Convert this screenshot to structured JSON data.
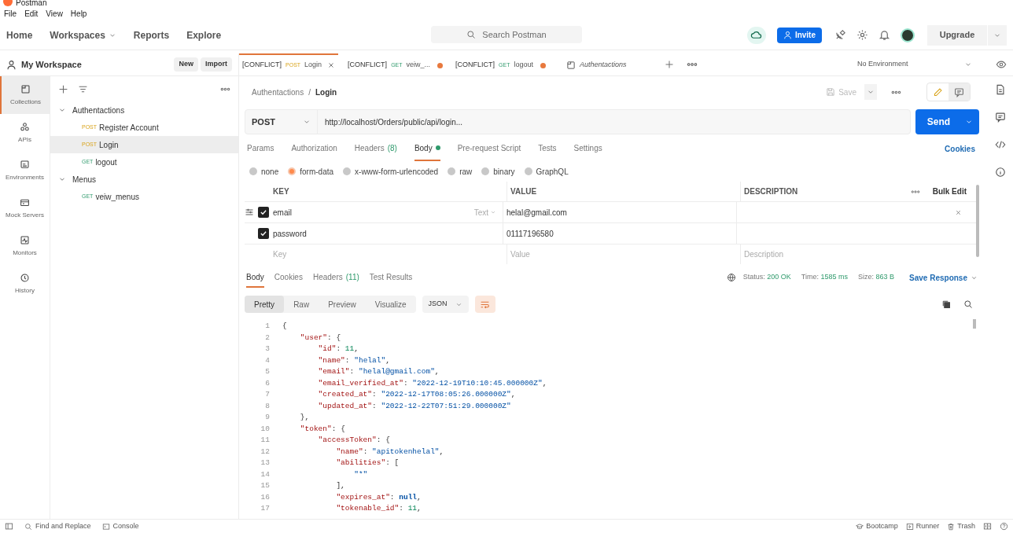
{
  "window": {
    "title": "Postman"
  },
  "menu": [
    "File",
    "Edit",
    "View",
    "Help"
  ],
  "nav": [
    {
      "label": "Home",
      "dropdown": false
    },
    {
      "label": "Workspaces",
      "dropdown": true
    },
    {
      "label": "Reports",
      "dropdown": false
    },
    {
      "label": "Explore",
      "dropdown": false
    }
  ],
  "search": {
    "placeholder": "Search Postman"
  },
  "invite": "Invite",
  "upgrade": "Upgrade",
  "workspace": {
    "name": "My Workspace",
    "buttons": [
      "New",
      "Import"
    ]
  },
  "rail": [
    {
      "label": "Collections",
      "selected": true
    },
    {
      "label": "APIs",
      "selected": false
    },
    {
      "label": "Environments",
      "selected": false
    },
    {
      "label": "Mock Servers",
      "selected": false
    },
    {
      "label": "Monitors",
      "selected": false
    },
    {
      "label": "History",
      "selected": false
    }
  ],
  "tree": [
    {
      "label": "Authentactions",
      "expanded": true,
      "children": [
        {
          "method": "POST",
          "label": "Register Account",
          "selected": false
        },
        {
          "method": "POST",
          "label": "Login",
          "selected": true
        },
        {
          "method": "GET",
          "label": "logout",
          "selected": false
        }
      ]
    },
    {
      "label": "Menus",
      "expanded": true,
      "children": [
        {
          "method": "GET",
          "label": "veiw_menus",
          "selected": false
        }
      ]
    }
  ],
  "tabs": [
    {
      "prefix": "[CONFLICT]",
      "method": "POST",
      "label": "Login",
      "selected": true,
      "unsaved": false,
      "kind": "request"
    },
    {
      "prefix": "[CONFLICT]",
      "method": "GET",
      "label": "veiw_...",
      "selected": false,
      "unsaved": true,
      "kind": "request"
    },
    {
      "prefix": "[CONFLICT]",
      "method": "GET",
      "label": "logout",
      "selected": false,
      "unsaved": true,
      "kind": "request"
    },
    {
      "label": "Authentactions",
      "selected": false,
      "unsaved": false,
      "kind": "collection"
    }
  ],
  "environment": "No Environment",
  "breadcrumb": {
    "parent": "Authentactions",
    "separator": "/",
    "current": "Login"
  },
  "save": "Save",
  "request": {
    "method": "POST",
    "url": "http://localhost/Orders/public/api/login...",
    "send": "Send"
  },
  "request_tabs": [
    {
      "label": "Params",
      "selected": false,
      "dot": false
    },
    {
      "label": "Authorization",
      "selected": false,
      "dot": false
    },
    {
      "label": "Headers",
      "count": "(8)",
      "selected": false,
      "dot": false
    },
    {
      "label": "Body",
      "selected": true,
      "dot": true
    },
    {
      "label": "Pre-request Script",
      "selected": false,
      "dot": false
    },
    {
      "label": "Tests",
      "selected": false,
      "dot": false
    },
    {
      "label": "Settings",
      "selected": false,
      "dot": false
    }
  ],
  "cookies": "Cookies",
  "body_types": [
    {
      "label": "none",
      "selected": false
    },
    {
      "label": "form-data",
      "selected": true
    },
    {
      "label": "x-www-form-urlencoded",
      "selected": false
    },
    {
      "label": "raw",
      "selected": false
    },
    {
      "label": "binary",
      "selected": false
    },
    {
      "label": "GraphQL",
      "selected": false
    }
  ],
  "form_table": {
    "columns": [
      "KEY",
      "VALUE",
      "DESCRIPTION"
    ],
    "bulk_edit": "Bulk Edit",
    "rows": [
      {
        "key": "email",
        "type": "Text",
        "value": "helal@gmail.com",
        "checked": true
      },
      {
        "key": "password",
        "value": "01117196580",
        "checked": true
      }
    ],
    "new_row": [
      {
        "placeholder": "Key"
      },
      {
        "placeholder": "Value"
      },
      {
        "placeholder": "Description"
      }
    ]
  },
  "response_tabs": [
    {
      "label": "Body",
      "selected": true
    },
    {
      "label": "Cookies",
      "selected": false
    },
    {
      "label": "Headers",
      "count": "(11)",
      "selected": false
    },
    {
      "label": "Test Results",
      "selected": false
    }
  ],
  "response_meta": [
    {
      "label": "Status:",
      "value": "200 OK"
    },
    {
      "label": "Time:",
      "value": "1585 ms"
    },
    {
      "label": "Size:",
      "value": "863 B"
    }
  ],
  "save_response": "Save Response",
  "view_modes": [
    {
      "label": "Pretty",
      "selected": true
    },
    {
      "label": "Raw",
      "selected": false
    },
    {
      "label": "Preview",
      "selected": false
    },
    {
      "label": "Visualize",
      "selected": false
    }
  ],
  "format": "JSON",
  "code": [
    {
      "n": "1",
      "text": "{"
    },
    {
      "n": "2",
      "text": "    \"user\": {"
    },
    {
      "n": "3",
      "text": "        \"id\": 11,"
    },
    {
      "n": "4",
      "text": "        \"name\": \"helal\","
    },
    {
      "n": "5",
      "text": "        \"email\": \"helal@gmail.com\","
    },
    {
      "n": "6",
      "text": "        \"email_verified_at\": \"2022-12-19T10:10:45.000000Z\","
    },
    {
      "n": "7",
      "text": "        \"created_at\": \"2022-12-17T08:05:26.000000Z\","
    },
    {
      "n": "8",
      "text": "        \"updated_at\": \"2022-12-22T07:51:29.000000Z\""
    },
    {
      "n": "9",
      "text": "    },"
    },
    {
      "n": "10",
      "text": "    \"token\": {"
    },
    {
      "n": "11",
      "text": "        \"accessToken\": {"
    },
    {
      "n": "12",
      "text": "            \"name\": \"apitokenhelal\","
    },
    {
      "n": "13",
      "text": "            \"abilities\": ["
    },
    {
      "n": "14",
      "text": "                \"*\""
    },
    {
      "n": "15",
      "text": "            ],"
    },
    {
      "n": "16",
      "text": "            \"expires_at\": null,"
    },
    {
      "n": "17",
      "text": "            \"tokenable_id\": 11,"
    }
  ],
  "status_bar": {
    "left": [
      "Find and Replace",
      "Console"
    ],
    "right": [
      "Bootcamp",
      "Runner",
      "Trash"
    ]
  }
}
